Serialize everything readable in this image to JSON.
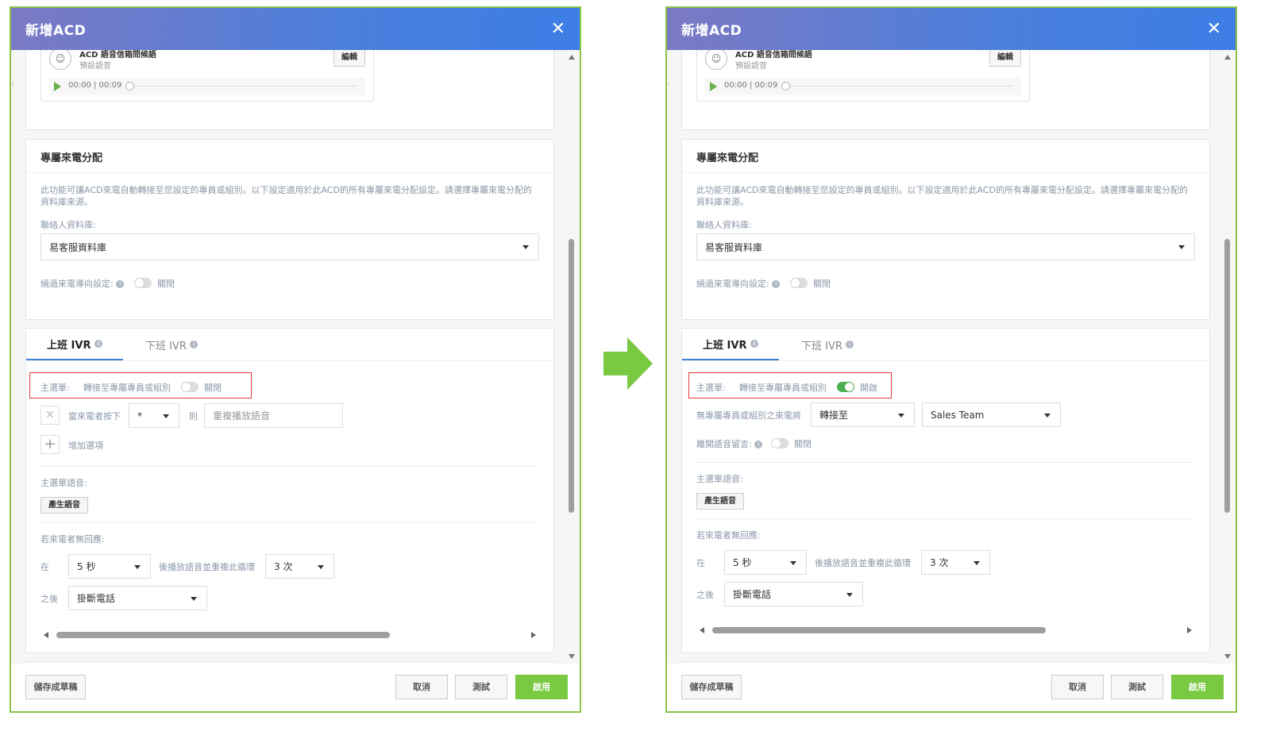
{
  "left": {
    "title": "新增ACD",
    "voice_name": "ACD 語音信箱問候語",
    "voice_sub": "預設語音",
    "edit_label": "編輯",
    "play_time": "00:00 | 00:09",
    "section_title": "專屬來電分配",
    "description": "此功能可讓ACD來電自動轉接至您設定的專員或組別。以下設定適用於此ACD的所有專屬來電分配設定。請選擇專屬來電分配的資料庫來源。",
    "db_label": "聯絡人資料庫:",
    "db_value": "易客服資料庫",
    "bypass_label": "繞過來電導向設定:",
    "bypass_state": "關閉",
    "tab_day": "上班 IVR",
    "tab_night": "下班 IVR",
    "main_menu_label": "主選單:",
    "transfer_label": "轉接至專屬專員或組別",
    "transfer_state": "關閉",
    "press_label": "當來電者按下",
    "key_value": "*",
    "then_label": "則",
    "action_placeholder": "重複播放語音",
    "add_option": "增加選項",
    "menu_voice_label": "主選單語音:",
    "gen_voice": "產生語音",
    "no_response_label": "若來電者無回應:",
    "at_label": "在",
    "seconds_value": "5 秒",
    "replay_label": "後播放語音並重複此循環",
    "times_value": "3 次",
    "after_label": "之後",
    "after_value": "掛斷電話",
    "save_draft": "儲存成草稿",
    "cancel": "取消",
    "test": "測試",
    "enable": "啟用"
  },
  "right": {
    "title": "新增ACD",
    "voice_name": "ACD 語音信箱問候語",
    "voice_sub": "預設語音",
    "edit_label": "編輯",
    "play_time": "00:00 | 00:09",
    "section_title": "專屬來電分配",
    "description": "此功能可讓ACD來電自動轉接至您設定的專員或組別。以下設定適用於此ACD的所有專屬來電分配設定。請選擇專屬來電分配的資料庫來源。",
    "db_label": "聯絡人資料庫:",
    "db_value": "易客服資料庫",
    "bypass_label": "繞過來電導向設定:",
    "bypass_state": "關閉",
    "tab_day": "上班 IVR",
    "tab_night": "下班 IVR",
    "main_menu_label": "主選單:",
    "transfer_label": "轉接至專屬專員或組別",
    "transfer_state": "開啟",
    "no_agent_label": "無專屬專員或組別之來電將",
    "forward_value": "轉接至",
    "team_value": "Sales Team",
    "leave_msg_label": "離開語音留言:",
    "leave_msg_state": "關閉",
    "menu_voice_label": "主選單語音:",
    "gen_voice": "產生語音",
    "no_response_label": "若來電者無回應:",
    "at_label": "在",
    "seconds_value": "5 秒",
    "replay_label": "後播放語音並重複此循環",
    "times_value": "3 次",
    "after_label": "之後",
    "after_value": "掛斷電話",
    "save_draft": "儲存成草稿",
    "cancel": "取消",
    "test": "測試",
    "enable": "啟用"
  },
  "colors": {
    "accent_green": "#7ac943",
    "highlight_red": "#e53935",
    "header_blue": "#3d7ee6",
    "toggle_on": "#4caf50"
  },
  "icons": {
    "close": "close-icon",
    "voice": "voice-icon",
    "play": "play-icon",
    "info": "info-icon",
    "arrow": "arrow-right-icon"
  }
}
